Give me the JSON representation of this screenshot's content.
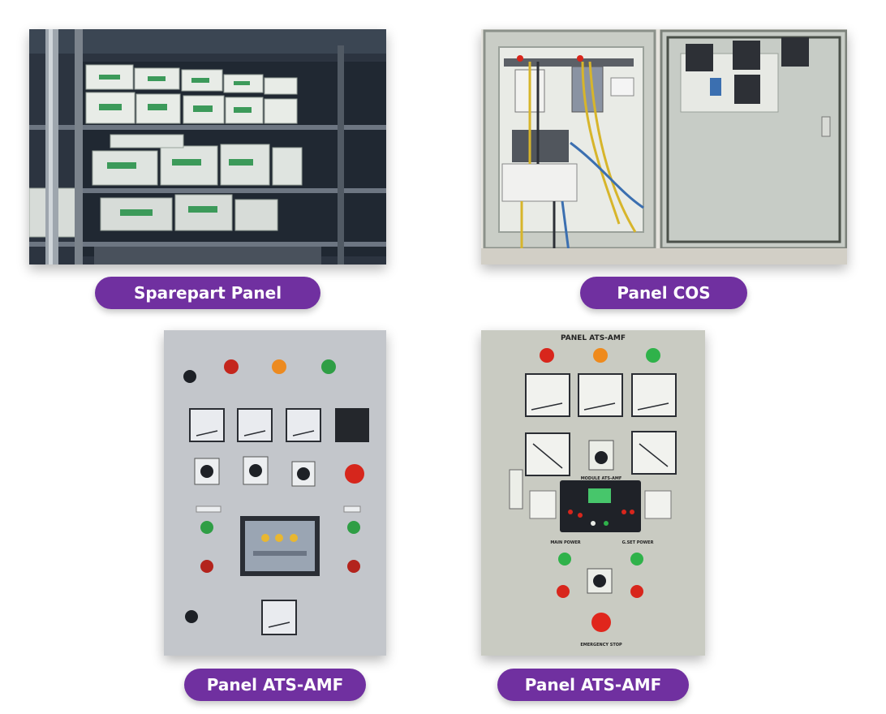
{
  "captions": {
    "sparepart": "Sparepart Panel",
    "cos": "Panel COS",
    "ats_left": "Panel ATS-AMF",
    "ats_right": "Panel ATS-AMF"
  },
  "panel_ats_right": {
    "plate_title": "PANEL ATS-AMF",
    "selector_label": "MODULE ATS-AMF",
    "main_power_label": "MAIN POWER",
    "genset_power_label": "G.SET POWER",
    "emergency_label": "EMERGENCY STOP"
  },
  "colors": {
    "caption_bg": "#7030a0",
    "lamp_red": "#d8261c",
    "lamp_orange": "#ef8a1c",
    "lamp_green": "#2fb24a"
  }
}
